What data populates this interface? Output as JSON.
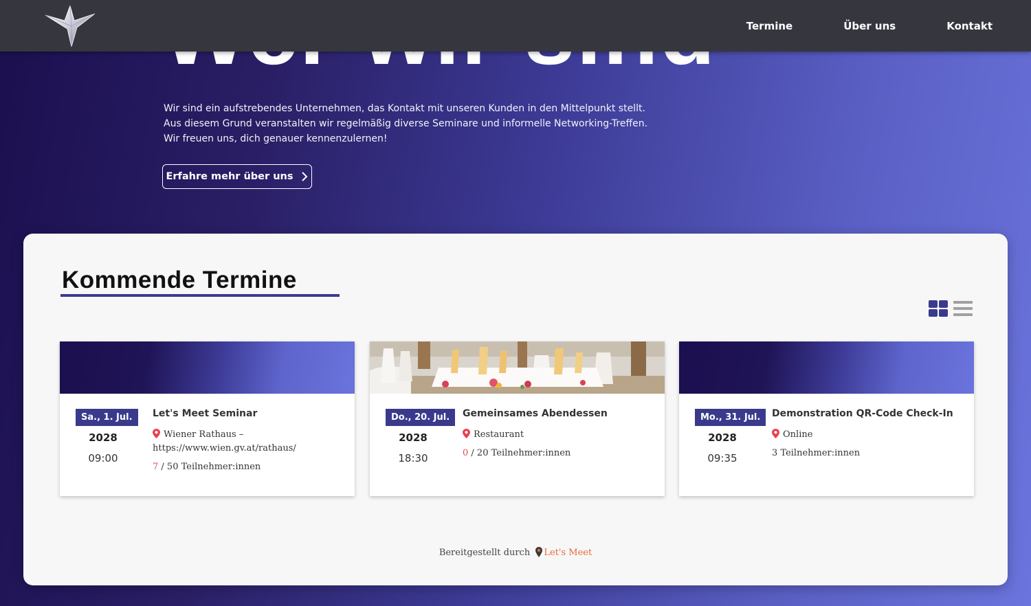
{
  "nav": {
    "logo_icon": "sparkle-star-icon",
    "links": [
      "Termine",
      "Über uns",
      "Kontakt"
    ]
  },
  "hero": {
    "title": "Wer wir sind",
    "lines": [
      "Wir sind ein aufstrebendes Unternehmen, das Kontakt mit unseren Kunden in den Mittelpunkt stellt.",
      "Aus diesem Grund veranstalten wir regelmäßig diverse Seminare und informelle Networking-Treffen.",
      "Wir freuen uns, dich genauer kennenzulernen!"
    ],
    "button_label": "Erfahre mehr über uns"
  },
  "events_section": {
    "title": "Kommende Termine",
    "view_toggle": [
      "grid-view-icon",
      "list-view-icon"
    ],
    "cards": [
      {
        "date": "Sa., 1. Jul.",
        "year": "2028",
        "time": "09:00",
        "title": "Let's Meet Seminar",
        "location": "Wiener Rathaus – https://www.wien.gv.at/rathaus/",
        "registered": "7",
        "capacity": "/ 50 Teilnehmer:innen",
        "banner": "gradient"
      },
      {
        "date": "Do., 20. Jul.",
        "year": "2028",
        "time": "18:30",
        "title": "Gemeinsames Abendessen",
        "location": "Restaurant",
        "registered": "0",
        "capacity": "/ 20 Teilnehmer:innen",
        "banner": "photo-banquet"
      },
      {
        "date": "Mo., 31. Jul.",
        "year": "2028",
        "time": "09:35",
        "title": "Demonstration QR-Code Check-In",
        "location": "Online",
        "participants": "3 Teilnehmer:innen",
        "banner": "gradient"
      }
    ]
  },
  "footer": {
    "prefix": "Bereitgestellt durch",
    "brand": "Let's Meet"
  },
  "colors": {
    "nav_bg": "#36363f",
    "accent": "#3a3a8c",
    "pin_red": "#e8424f",
    "brand_orange": "#e86a3a"
  }
}
